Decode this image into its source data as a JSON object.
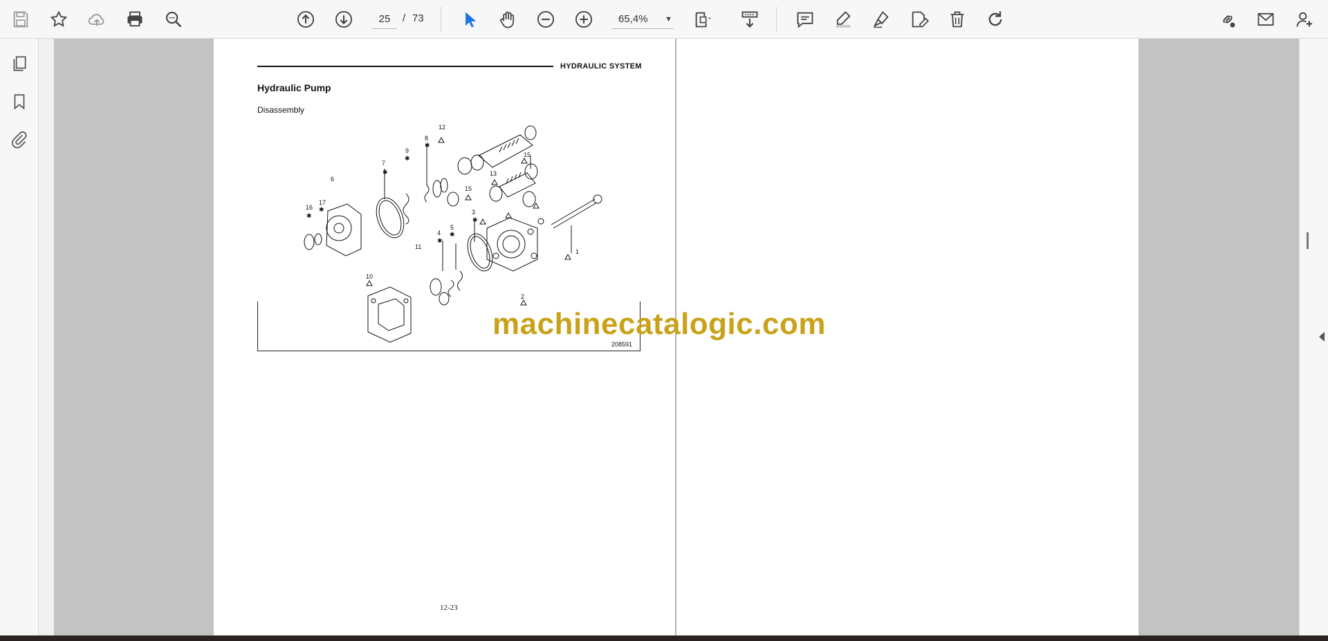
{
  "toolbar": {
    "current_page": "25",
    "page_separator": "/",
    "total_pages": "73",
    "zoom_level": "65,4%",
    "icons": [
      "save-icon",
      "bookmark-star-icon",
      "cloud-upload-icon",
      "print-icon",
      "find-text-icon",
      "previous-page-icon",
      "next-page-icon",
      "select-cursor-icon",
      "hand-tool-icon",
      "zoom-out-icon",
      "zoom-in-icon",
      "page-fit-icon",
      "scroll-mode-icon",
      "comment-icon",
      "highlight-icon",
      "sign-pen-icon",
      "edit-pdf-icon",
      "delete-icon",
      "rotate-icon",
      "share-link-icon",
      "email-icon",
      "add-user-icon"
    ]
  },
  "left_rail": {
    "icons": [
      "pages-thumbnails-icon",
      "bookmarks-icon",
      "attachments-icon"
    ]
  },
  "document": {
    "section_header": "HYDRAULIC SYSTEM",
    "title": "Hydraulic Pump",
    "subtitle": "Disassembly",
    "figure_number": "208591",
    "page_footer": "12-23",
    "callouts": [
      "1",
      "2",
      "3",
      "4",
      "5",
      "6",
      "7",
      "8",
      "9",
      "10",
      "11",
      "12",
      "13",
      "15",
      "15",
      "16",
      "17"
    ]
  },
  "watermark": "machinecatalogic.com",
  "colors": {
    "accent": "#1a73e8",
    "watermark": "#c9a21a",
    "page_gray": "#c3c3c3"
  }
}
